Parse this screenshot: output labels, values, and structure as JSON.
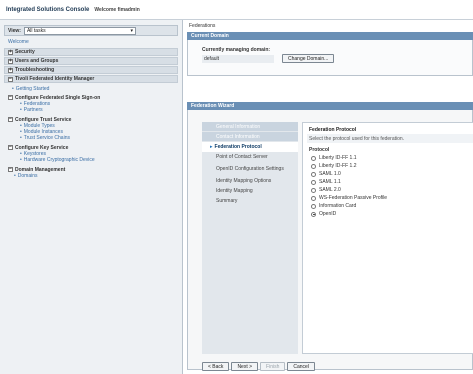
{
  "banner": {
    "title": "Integrated Solutions Console",
    "welcome": "Welcome fimadmin"
  },
  "nav": {
    "view_label": "View:",
    "view_value": "All tasks",
    "welcome": "Welcome",
    "sections": [
      "Security",
      "Users and Groups",
      "Troubleshooting"
    ],
    "tfim": "Tivoli Federated Identity Manager",
    "getting_started": "Getting Started",
    "groups": [
      {
        "label": "Configure Federated Single Sign-on",
        "items": [
          "Federations",
          "Partners"
        ]
      },
      {
        "label": "Configure Trust Service",
        "items": [
          "Module Types",
          "Module Instances",
          "Trust Service Chains"
        ]
      },
      {
        "label": "Configure Key Service",
        "items": [
          "Keystores",
          "Hardware Cryptographic Device"
        ]
      },
      {
        "label": "Domain Management",
        "items": [
          "Domains"
        ]
      }
    ]
  },
  "main": {
    "breadcrumb": "Federations",
    "current_domain": {
      "header": "Current Domain",
      "label": "Currently managing domain:",
      "value": "default",
      "change_button": "Change Domain..."
    },
    "wizard": {
      "header": "Federation Wizard",
      "steps": [
        "General Information",
        "Contact Information",
        "Federation Protocol",
        "Point of Contact Server",
        "OpenID Configuration Settings",
        "Identity Mapping Options",
        "Identity Mapping",
        "Summary"
      ],
      "content_title": "Federation Protocol",
      "content_sub": "Select the protocol used for this federation.",
      "protocol_label": "Protocol",
      "protocols": [
        "Liberty ID-FF 1.1",
        "Liberty ID-FF 1.2",
        "SAML 1.0",
        "SAML 1.1",
        "SAML 2.0",
        "WS-Federation Passive Profile",
        "Information Card",
        "OpenID"
      ],
      "selected": "OpenID",
      "buttons": [
        "< Back",
        "Next >",
        "Finish",
        "Cancel"
      ]
    }
  }
}
